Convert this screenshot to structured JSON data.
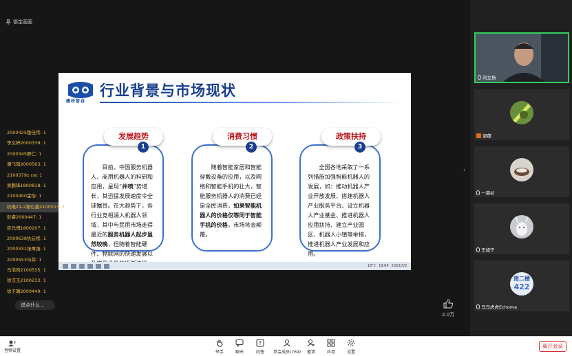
{
  "meeting": {
    "pin_label": "锁定画面"
  },
  "slide": {
    "logo_text": "建桥智谷",
    "title": "行业背景与市场现状",
    "cards": [
      {
        "badge": "发展趋势",
        "num": "1",
        "text_a": "目前，中国服务机器人、商用机器人的科研和应用，呈现“",
        "bold_a": "井喷",
        "text_b": "”势增长，其迅猛发展速度令全球瞩目。在大趋势下，各行业竞相涌入机器人领域，其中与民用市场走得最近的",
        "bold_b": "服务机器人起步虽然较晚",
        "text_c": "，但随着智能硬件、物联网的快速发展以及应用场景的逐渐清晰。"
      },
      {
        "badge": "消费习惯",
        "num": "2",
        "text_a": "随着智能家居和智能穿戴设备的应用，以及网络和智能手机的壮大，智能服务机器人的消费已经是全民消费，",
        "bold_a": "如果智能机器人的价格仅等同于智能手机的价格",
        "text_b": "，市场将会颠覆。"
      },
      {
        "badge": "政策扶持",
        "num": "3",
        "text_a": "全国各地采取了一系列措施加强智能机器人的发展，如：推动机器人产业开放发展、搭建机器人产业服务平台、设立机器人产业基金、推进机器人应用扶持、建立产业园区、机器人小镇等举措，推进机器人产业发展和应用。"
      }
    ]
  },
  "taskbar": {
    "temp": "18°C",
    "time": "19:04",
    "date": "2023/3/3"
  },
  "chat": {
    "items": [
      "2000425楚佳伟: 1",
      "李文婷2000339: 1",
      "2000345卿仁: 1",
      "谢飞萌2000563: 1",
      "2100379z cw: 1",
      "吴鹏锋1800818: 1",
      "2100400金怡: 1",
      "机电21-2谢亿鑫2100513: 1",
      "彭睿2000447: 1",
      "应元博1800207: 1",
      "2000638仇云程: 1",
      "2000331张再强: 1",
      "2000553马菲: 1",
      "马浩然2100535: 1",
      "徐汉玉2100233: 1",
      "徐子璐2000440: 1"
    ],
    "input_placeholder": "说点什么..."
  },
  "likes": {
    "count": "2.0万"
  },
  "participants": [
    {
      "name": "刘立扬",
      "active": true
    },
    {
      "name": "郭葆",
      "active": false
    },
    {
      "name": "一袭衫",
      "active": false
    },
    {
      "name": "王旭宁",
      "active": false
    },
    {
      "name": "马马虎虎Echoma",
      "active": false
    }
  ],
  "tile_texts": {
    "badge_top": "南二楼",
    "badge_num": "422"
  },
  "toolbar": {
    "audio": "音频设置",
    "buttons": [
      "举手",
      "聊天",
      "问答",
      "参会成员(769)",
      "邀请",
      "应用",
      "设置"
    ],
    "leave": "离开会议"
  }
}
